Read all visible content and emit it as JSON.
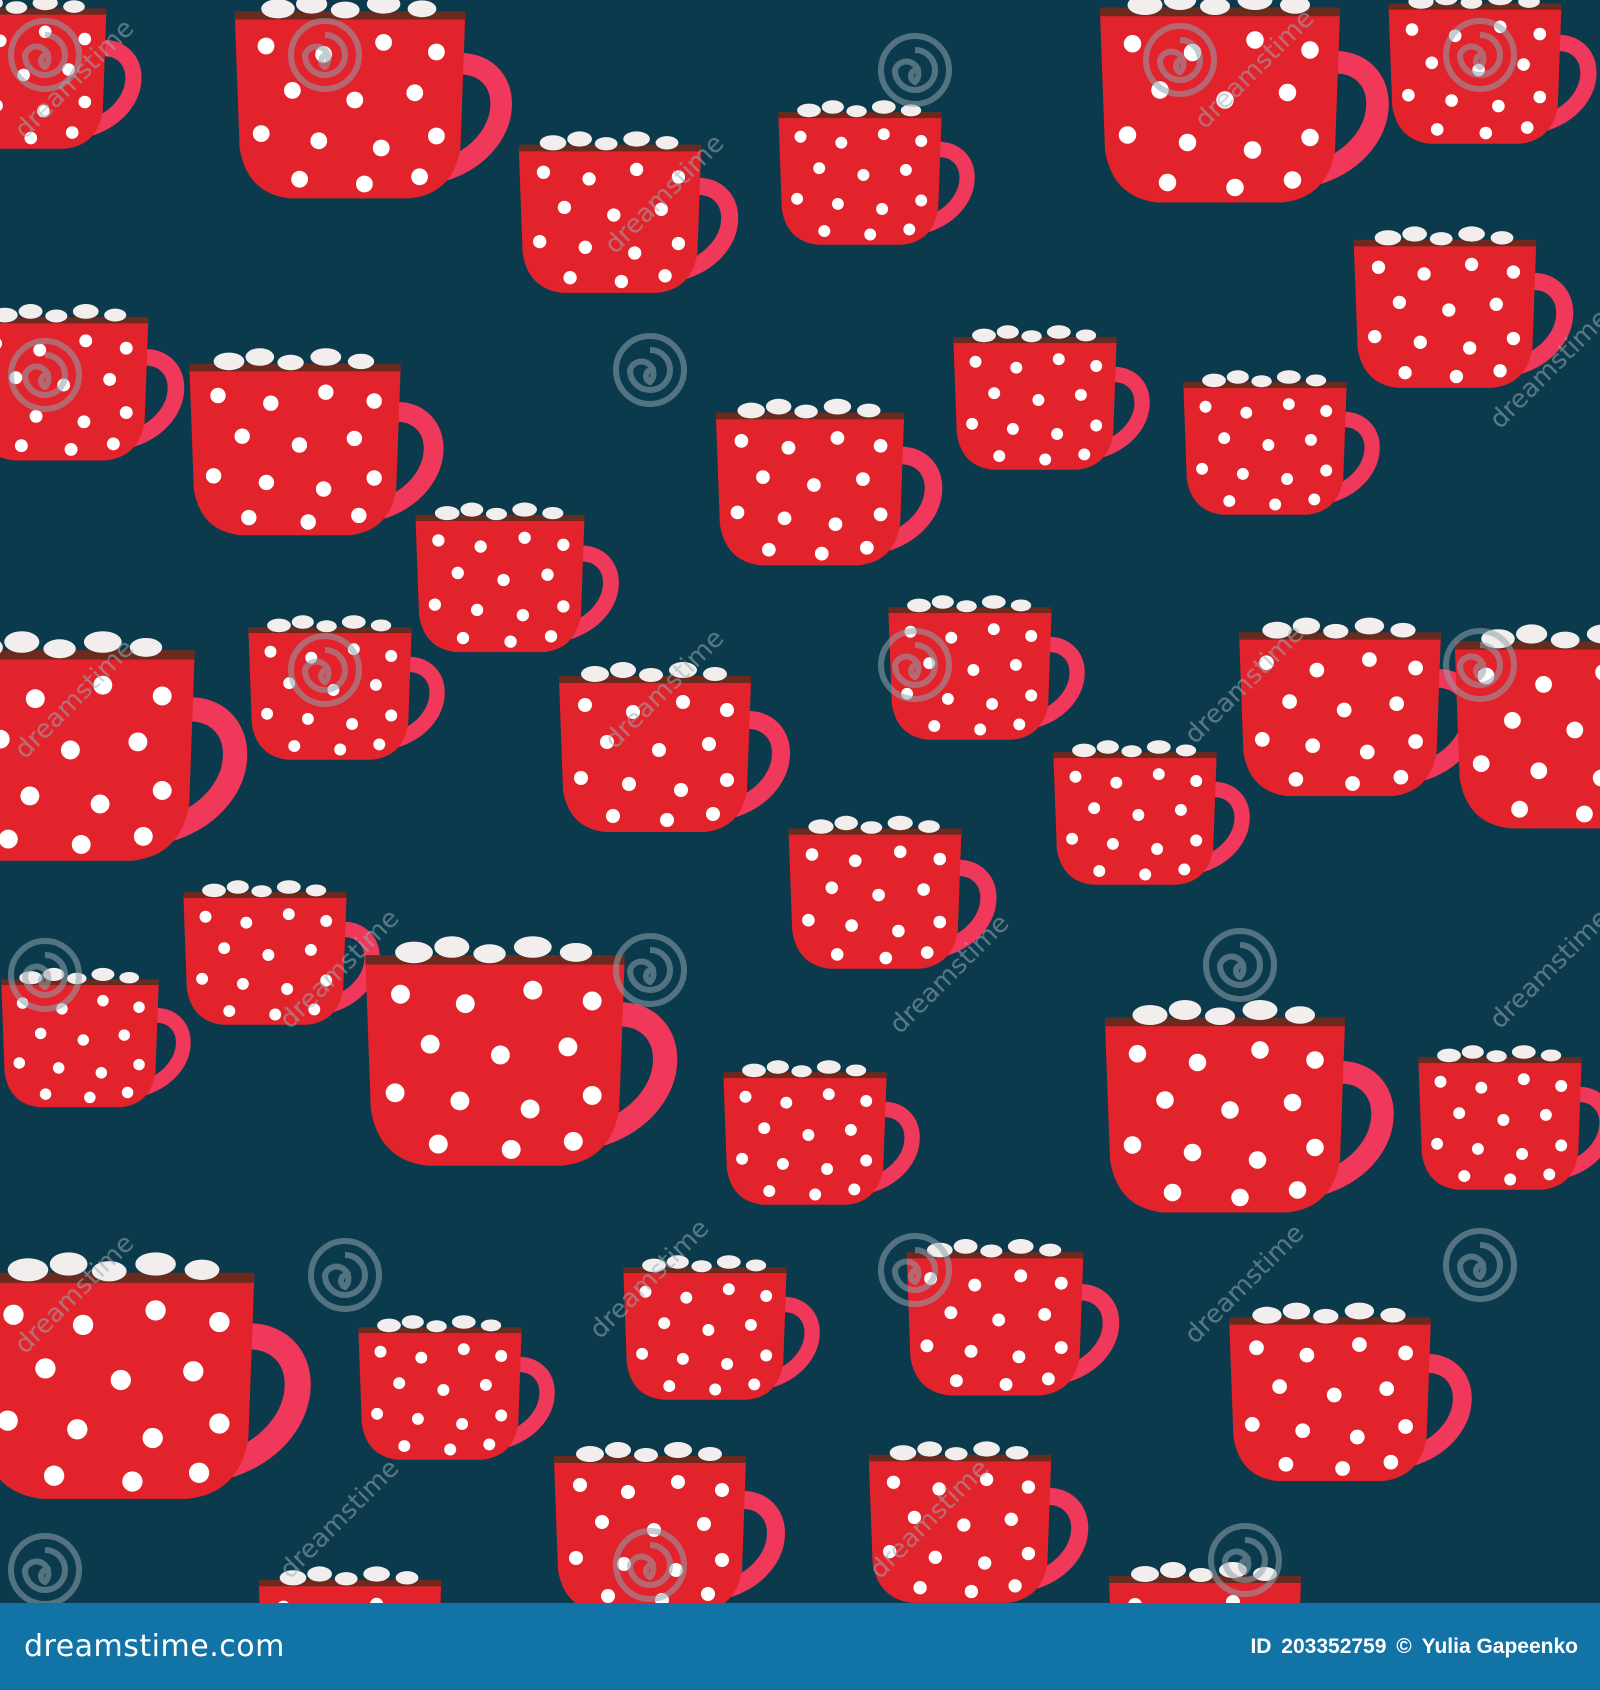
{
  "image": {
    "background_color": "#0b3a4c",
    "mug_color": "#e3232b",
    "handle_color": "#f0385a",
    "dot_color": "#ffffff",
    "marshmallow_color": "#f3eeee",
    "cocoa_color": "#6b2a1e",
    "watermark_icon": "spiral-watermark-icon",
    "watermark_text": "dreamstime"
  },
  "footer": {
    "brand": "dreamstime.com",
    "id_label": "ID",
    "id_value": "203352759",
    "copyright": "©",
    "author": "Yulia Gapeenko",
    "background_color": "#1173a6"
  }
}
